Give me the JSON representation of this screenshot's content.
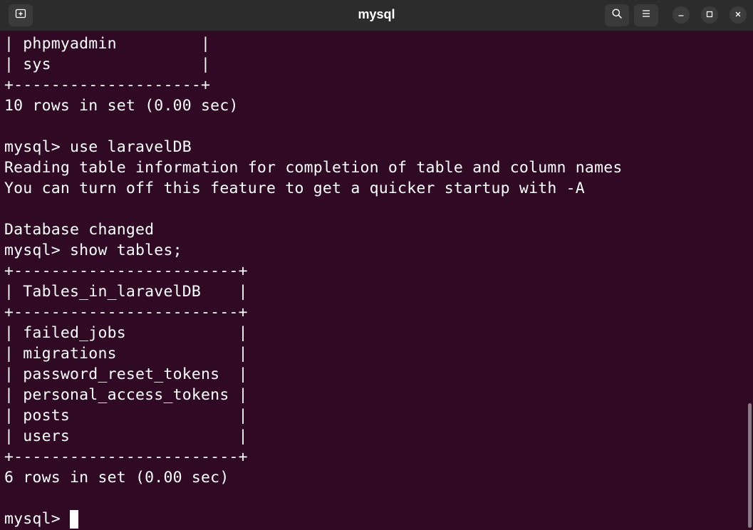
{
  "window": {
    "title": "mysql"
  },
  "icons": {
    "new_tab": "new-tab-icon",
    "search": "search-icon",
    "menu": "hamburger-menu-icon",
    "minimize": "minimize-icon",
    "maximize": "maximize-icon",
    "close": "close-icon"
  },
  "colors": {
    "terminal_bg": "#300a24",
    "titlebar_bg": "#2c2c2c",
    "text": "#ffffff"
  },
  "terminal": {
    "lines": [
      "| phpmyadmin         |",
      "| sys                |",
      "+--------------------+",
      "10 rows in set (0.00 sec)",
      "",
      "mysql> use laravelDB",
      "Reading table information for completion of table and column names",
      "You can turn off this feature to get a quicker startup with -A",
      "",
      "Database changed",
      "mysql> show tables;",
      "+------------------------+",
      "| Tables_in_laravelDB    |",
      "+------------------------+",
      "| failed_jobs            |",
      "| migrations             |",
      "| password_reset_tokens  |",
      "| personal_access_tokens |",
      "| posts                  |",
      "| users                  |",
      "+------------------------+",
      "6 rows in set (0.00 sec)",
      ""
    ],
    "prompt": "mysql> "
  }
}
